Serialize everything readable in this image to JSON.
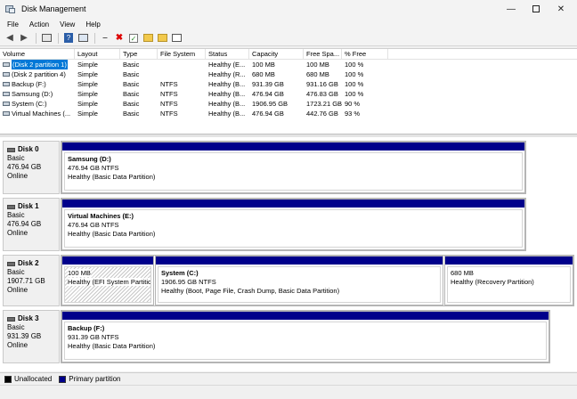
{
  "window": {
    "title": "Disk Management"
  },
  "menu": [
    "File",
    "Action",
    "View",
    "Help"
  ],
  "toolbar_icons": [
    "back-arrow-icon",
    "forward-arrow-icon",
    "console-tree-icon",
    "help-icon",
    "help-topic-icon",
    "connect-icon",
    "delete-icon",
    "check-icon",
    "folder-up-icon",
    "properties-icon",
    "list-icon"
  ],
  "columns": [
    "Volume",
    "Layout",
    "Type",
    "File System",
    "Status",
    "Capacity",
    "Free Spa...",
    "% Free"
  ],
  "volumes": [
    [
      "(Disk 2 partition 1)",
      "Simple",
      "Basic",
      "",
      "Healthy (E...",
      "100 MB",
      "100 MB",
      "100 %"
    ],
    [
      "(Disk 2 partition 4)",
      "Simple",
      "Basic",
      "",
      "Healthy (R...",
      "680 MB",
      "680 MB",
      "100 %"
    ],
    [
      "Backup (F:)",
      "Simple",
      "Basic",
      "NTFS",
      "Healthy (B...",
      "931.39 GB",
      "931.16 GB",
      "100 %"
    ],
    [
      "Samsung (D:)",
      "Simple",
      "Basic",
      "NTFS",
      "Healthy (B...",
      "476.94 GB",
      "476.83 GB",
      "100 %"
    ],
    [
      "System (C:)",
      "Simple",
      "Basic",
      "NTFS",
      "Healthy (B...",
      "1906.95 GB",
      "1723.21 GB",
      "90 %"
    ],
    [
      "Virtual Machines (...",
      "Simple",
      "Basic",
      "NTFS",
      "Healthy (B...",
      "476.94 GB",
      "442.76 GB",
      "93 %"
    ]
  ],
  "disks": [
    {
      "name": "Disk 0",
      "type": "Basic",
      "size": "476.94 GB",
      "status": "Online",
      "partitions": [
        {
          "title": "Samsung  (D:)",
          "size": "476.94 GB NTFS",
          "status": "Healthy (Basic Data Partition)"
        }
      ]
    },
    {
      "name": "Disk 1",
      "type": "Basic",
      "size": "476.94 GB",
      "status": "Online",
      "partitions": [
        {
          "title": "Virtual Machines  (E:)",
          "size": "476.94 GB NTFS",
          "status": "Healthy (Basic Data Partition)"
        }
      ]
    },
    {
      "name": "Disk 2",
      "type": "Basic",
      "size": "1907.71 GB",
      "status": "Online",
      "partitions": [
        {
          "title": "",
          "size": "100 MB",
          "status": "Healthy (EFI System Partitio"
        },
        {
          "title": "System  (C:)",
          "size": "1906.95 GB NTFS",
          "status": "Healthy (Boot, Page File, Crash Dump, Basic Data Partition)"
        },
        {
          "title": "",
          "size": "680 MB",
          "status": "Healthy (Recovery Partition)"
        }
      ]
    },
    {
      "name": "Disk 3",
      "type": "Basic",
      "size": "931.39 GB",
      "status": "Online",
      "partitions": [
        {
          "title": "Backup  (F:)",
          "size": "931.39 GB NTFS",
          "status": "Healthy (Basic Data Partition)"
        }
      ]
    }
  ],
  "legend": [
    {
      "label": "Unallocated",
      "color": "#000000"
    },
    {
      "label": "Primary partition",
      "color": "#00008b"
    }
  ]
}
